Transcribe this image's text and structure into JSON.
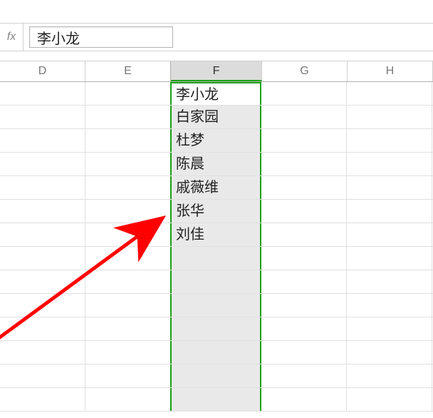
{
  "formula_bar": {
    "fx_label": "fx",
    "value": "李小龙"
  },
  "columns": [
    {
      "id": "D",
      "label": "D",
      "selected": false
    },
    {
      "id": "E",
      "label": "E",
      "selected": false
    },
    {
      "id": "F",
      "label": "F",
      "selected": true
    },
    {
      "id": "G",
      "label": "G",
      "selected": false
    },
    {
      "id": "H",
      "label": "H",
      "selected": false
    }
  ],
  "selected_column": "F",
  "active_cell_row": 0,
  "data_column_F": [
    "李小龙",
    "白家园",
    "杜梦",
    "陈晨",
    "戚薇维",
    "张华",
    "刘佳",
    "",
    "",
    "",
    "",
    "",
    "",
    ""
  ],
  "row_count": 14,
  "icons": {
    "fx": "fx"
  }
}
